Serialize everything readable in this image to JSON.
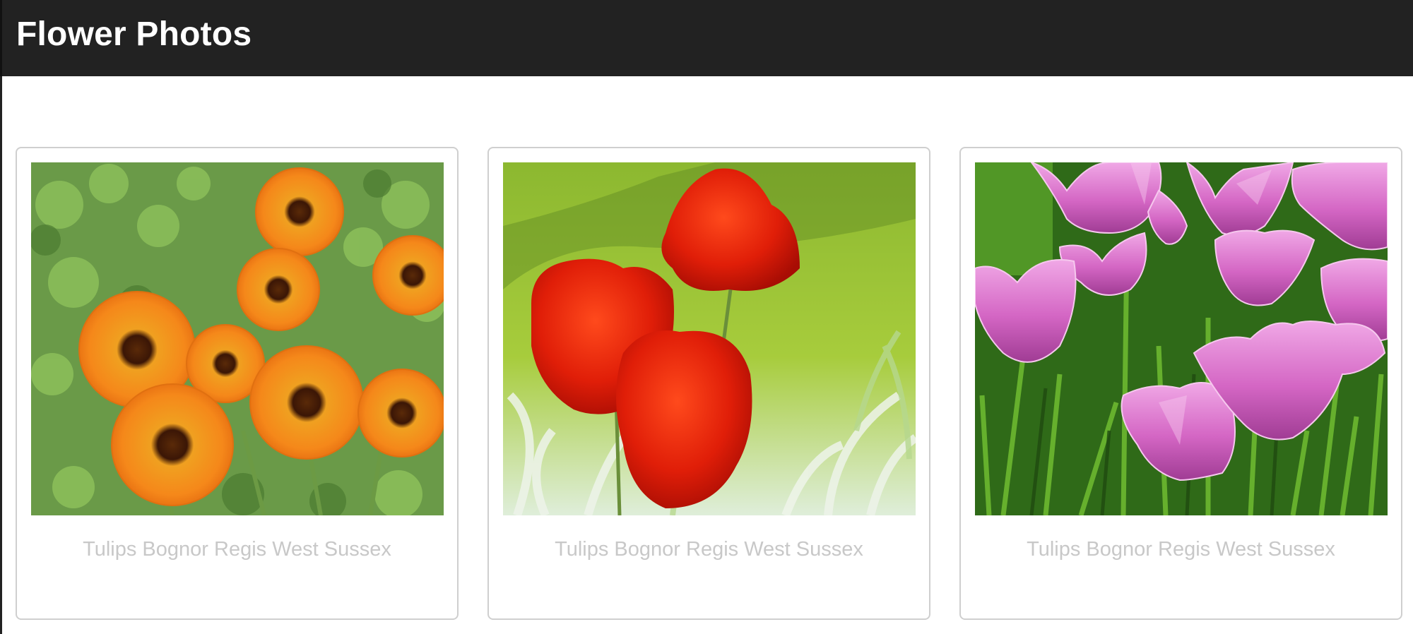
{
  "header": {
    "title": "Flower Photos",
    "background": "#222222"
  },
  "gallery": {
    "cards": [
      {
        "caption": "Tulips Bognor Regis West Sussex",
        "tulip_color": "orange",
        "accent": "#f28a1e"
      },
      {
        "caption": "Tulips Bognor Regis West Sussex",
        "tulip_color": "red",
        "accent": "#d8200e"
      },
      {
        "caption": "Tulips Bognor Regis West Sussex",
        "tulip_color": "pink",
        "accent": "#d46fc4"
      }
    ],
    "caption_color": "#c8c8c8",
    "card_border_color": "#cfcfcf"
  }
}
